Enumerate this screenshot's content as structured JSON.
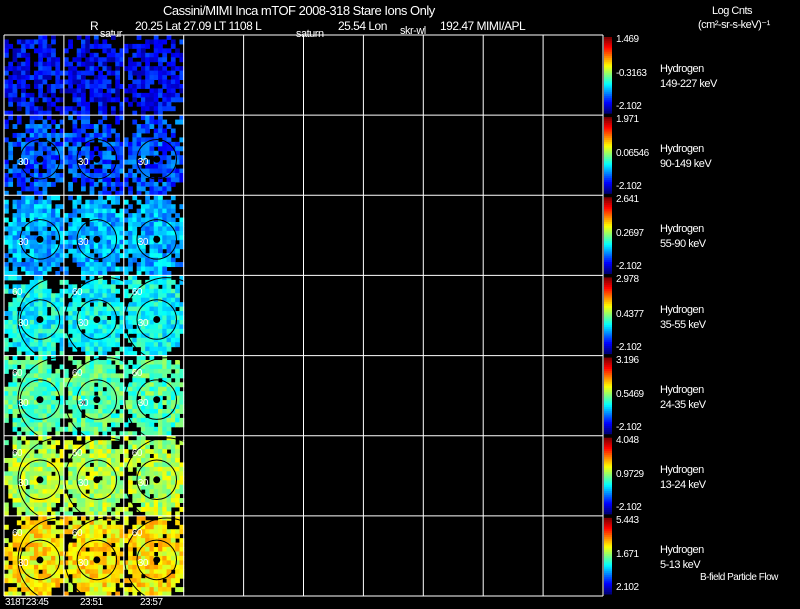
{
  "header": {
    "title": "Cassini/MIMI Inca mTOF  2008-318   Stare   Ions Only",
    "r_label": "R",
    "info": "20.25 Lat 27.09 LT 1108 L",
    "lon": "25.54 Lon",
    "lon_val": "192.47  MIMI/APL",
    "satur1": "satur",
    "saturn": "saturn",
    "skr": "skr-wl",
    "units_1": "Log Cnts",
    "units_2": "(cm²-sr-s-keV)⁻¹"
  },
  "footer": {
    "times": [
      "318T23:45",
      "23:51",
      "23:57"
    ],
    "legend": "B-field Particle Flow"
  },
  "chart_data": {
    "type": "heatmap",
    "title": "Cassini/MIMI Inca mTOF  2008-318   Stare   Ions Only",
    "columns": 10,
    "filled_columns": 3,
    "rows": [
      {
        "species": "Hydrogen",
        "energy": "149-227 keV",
        "max": "1.469",
        "mid": "-0.3163",
        "min": "-2.102",
        "level": 0.12
      },
      {
        "species": "Hydrogen",
        "energy": "90-149 keV",
        "max": "1.971",
        "mid": "0.06546",
        "min": "-2.102",
        "level": 0.2
      },
      {
        "species": "Hydrogen",
        "energy": "55-90 keV",
        "max": "2.641",
        "mid": "0.2697",
        "min": "-2.102",
        "level": 0.3
      },
      {
        "species": "Hydrogen",
        "energy": "35-55 keV",
        "max": "2.978",
        "mid": "0.4377",
        "min": "-2.102",
        "level": 0.38
      },
      {
        "species": "Hydrogen",
        "energy": "24-35 keV",
        "max": "3.196",
        "mid": "0.5469",
        "min": "-2.102",
        "level": 0.46
      },
      {
        "species": "Hydrogen",
        "energy": "13-24 keV",
        "max": "4.048",
        "mid": "0.9729",
        "min": "-2.102",
        "level": 0.55
      },
      {
        "species": "Hydrogen",
        "energy": "5-13 keV",
        "max": "5.443",
        "mid": "1.671",
        "min": "2.102",
        "level": 0.64
      }
    ],
    "contour_labels": [
      "30",
      "60"
    ]
  }
}
